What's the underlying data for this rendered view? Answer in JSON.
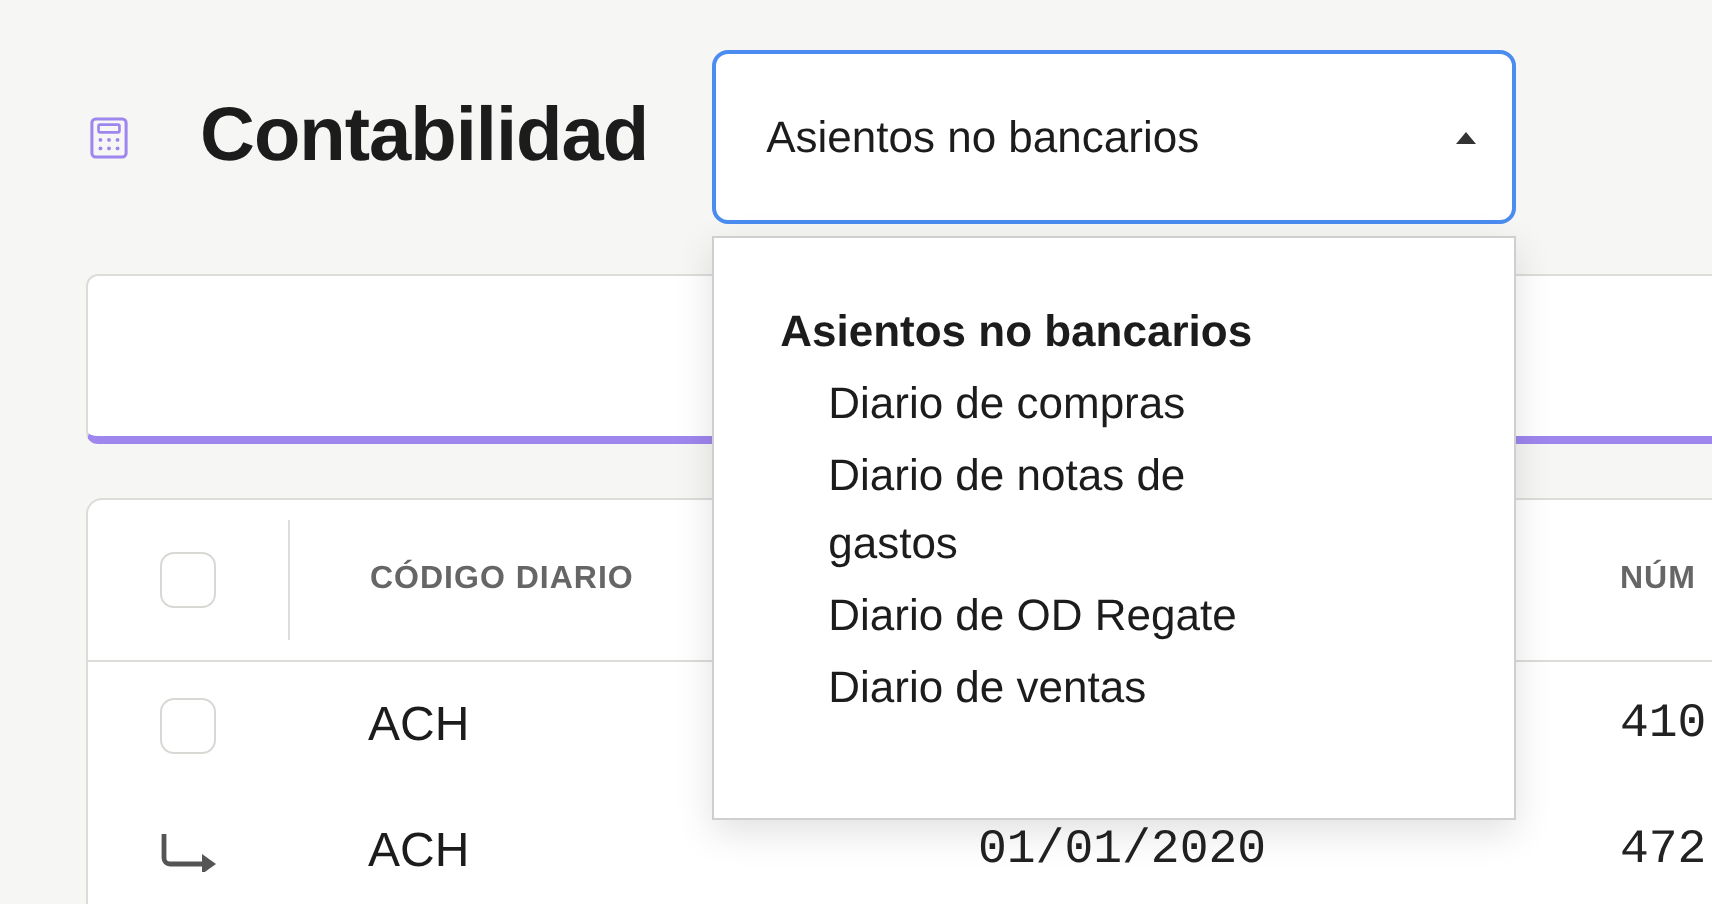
{
  "header": {
    "title": "Contabilidad"
  },
  "journal_select": {
    "value": "Asientos no bancarios",
    "expanded": true
  },
  "dropdown": {
    "groups": [
      {
        "label": "Asientos no bancarios",
        "items": [
          "Diario de compras",
          "Diario de notas de gastos",
          "Diario de OD Regate",
          "Diario de ventas"
        ]
      }
    ]
  },
  "table": {
    "select_all": {
      "checked": false
    },
    "columns": {
      "code": "CÓDIGO DIARIO",
      "number": "NÚM"
    },
    "rows": [
      {
        "kind": "checkbox",
        "checked": false,
        "code": "ACH",
        "number": "410"
      },
      {
        "kind": "child",
        "code": "ACH",
        "date": "01/01/2020",
        "number": "472"
      }
    ]
  }
}
